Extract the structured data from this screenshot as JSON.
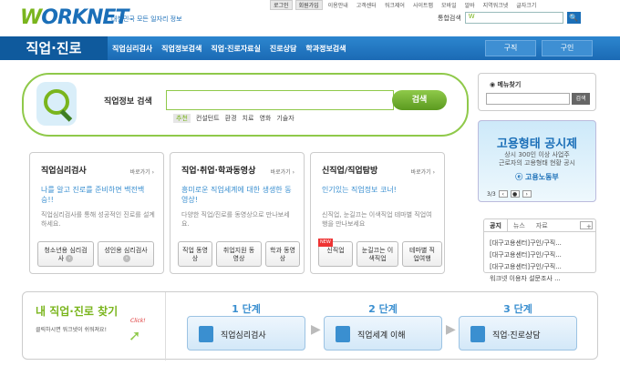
{
  "header": {
    "logo_mark": "W",
    "logo_text": "ORKNET",
    "tagline": "대한민국 모든 일자리 정보",
    "util_links": [
      "로그인",
      "회원가입",
      "이용안내",
      "고객센터",
      "워크제어",
      "사이트맵",
      "모바일",
      "알바",
      "지역워크넷",
      "글자크기"
    ],
    "search_label": "통합검색",
    "search_value": "W",
    "search_button": "🔍"
  },
  "gnb": {
    "home": "직업·진로",
    "menu": [
      "직업심리검사",
      "직업정보검색",
      "직업·진로자료실",
      "진로상담",
      "학과정보검색"
    ],
    "right": [
      "구직",
      "구인"
    ]
  },
  "main_search": {
    "label": "직업정보 검색",
    "button": "검색",
    "rec_tag": "추천",
    "recommended": [
      "컨설턴트",
      "환경",
      "치료",
      "영화",
      "기술자"
    ]
  },
  "menu_finder": {
    "title": "◉ 메뉴찾기",
    "button": "검색"
  },
  "banner": {
    "headline": "고용형태 공시제",
    "line1": "상시 300인 이상 사업주",
    "line2": "근로자의 고용형태 현황 공시",
    "org": "ⓔ 고용노동부",
    "page": "3/3"
  },
  "cards": [
    {
      "title": "직업심리검사",
      "more": "바로가기 ›",
      "lead": "나를 알고 진로를 준비하면 백전백승!!",
      "desc": "직업심리검사를 통해 성공적인 진로를 설계하세요.",
      "buttons": [
        "청소년용 심리검사",
        "성인용 심리검사"
      ]
    },
    {
      "title": "직업·취업·학과동영상",
      "more": "바로가기 ›",
      "lead": "흥미로운 직업세계에 대한 생생한 동영상!",
      "desc": "다양한 직업/진로를 동영상으로 만나보세요.",
      "buttons": [
        "직업 동영상",
        "취업지원 동영상",
        "학과 동영상"
      ]
    },
    {
      "title": "신직업/직업탐방",
      "more": "바로가기 ›",
      "lead": "인기있는 직업정보 코너!",
      "desc": "신직업, 눈길끄는 이색직업 테마별 직업여행을 만나보세요",
      "buttons": [
        "신직업",
        "눈길끄는 이색직업",
        "테마별 직업여행"
      ],
      "new": "NEW"
    }
  ],
  "news_tabs": {
    "tabs": [
      "공지",
      "뉴스",
      "자료"
    ],
    "plus": "+",
    "items": [
      "[대구고용센터]구인/구직...",
      "[대구고용센터]구인/구직...",
      "[대구고용센터]구인/구직...",
      "워크넷 이용자 설문조사 ..."
    ]
  },
  "steps": {
    "title": "내 직업·진로 찾기",
    "sub": "클릭하시면 워크넷이 쉬워져요!",
    "click": "Click!",
    "items": [
      {
        "label": "1 단계",
        "name": "직업심리검사"
      },
      {
        "label": "2 단계",
        "name": "직업세계 이해"
      },
      {
        "label": "3 단계",
        "name": "직업·진로상담"
      }
    ]
  }
}
